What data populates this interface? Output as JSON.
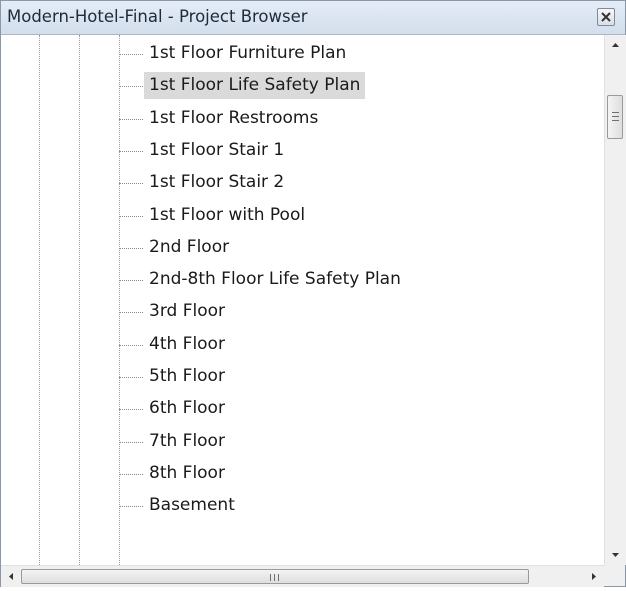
{
  "window": {
    "title": "Modern-Hotel-Final - Project Browser",
    "close_icon": "close-icon"
  },
  "tree": {
    "items": [
      {
        "label": "1st Floor Furniture Plan",
        "selected": false
      },
      {
        "label": "1st Floor Life Safety Plan",
        "selected": true
      },
      {
        "label": "1st Floor Restrooms",
        "selected": false
      },
      {
        "label": "1st Floor Stair 1",
        "selected": false
      },
      {
        "label": "1st Floor Stair 2",
        "selected": false
      },
      {
        "label": "1st Floor with Pool",
        "selected": false
      },
      {
        "label": "2nd Floor",
        "selected": false
      },
      {
        "label": "2nd-8th Floor Life Safety Plan",
        "selected": false
      },
      {
        "label": "3rd Floor",
        "selected": false
      },
      {
        "label": "4th Floor",
        "selected": false
      },
      {
        "label": "5th Floor",
        "selected": false
      },
      {
        "label": "6th Floor",
        "selected": false
      },
      {
        "label": "7th Floor",
        "selected": false
      },
      {
        "label": "8th Floor",
        "selected": false
      },
      {
        "label": "Basement",
        "selected": false
      }
    ]
  },
  "colors": {
    "selection_bg": "#dadada",
    "titlebar": "#dce6f2",
    "text": "#1a1a1a"
  }
}
